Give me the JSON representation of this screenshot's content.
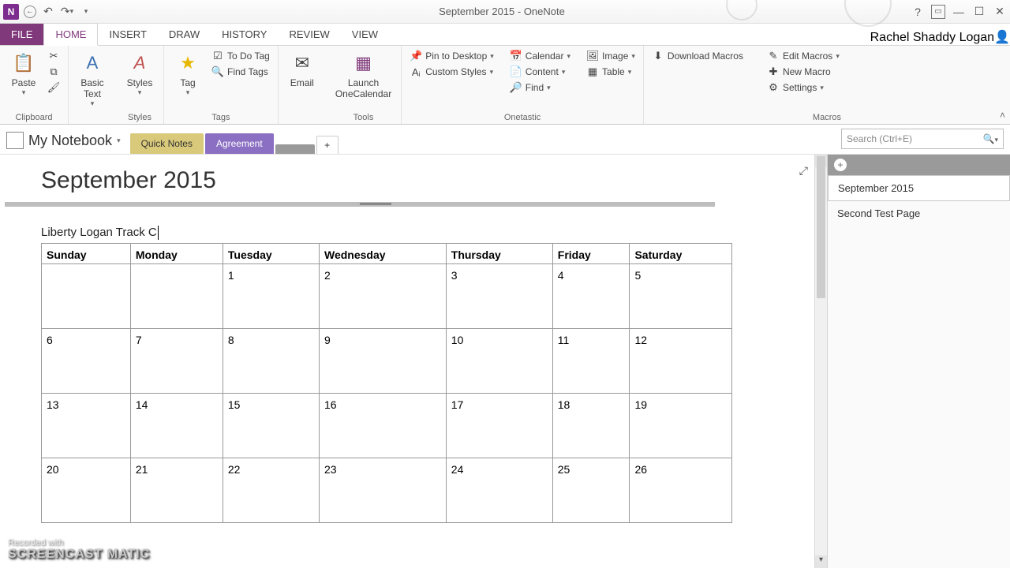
{
  "window": {
    "title": "September 2015 - OneNote"
  },
  "user": {
    "name": "Rachel Shaddy Logan"
  },
  "ribbon_tabs": [
    "FILE",
    "HOME",
    "INSERT",
    "DRAW",
    "HISTORY",
    "REVIEW",
    "VIEW"
  ],
  "active_tab": "HOME",
  "ribbon": {
    "clipboard": {
      "paste": "Paste",
      "title": "Clipboard"
    },
    "basictext": {
      "label1": "Basic",
      "label2": "Text",
      "title": ""
    },
    "styles": {
      "label": "Styles",
      "title": "Styles"
    },
    "tags": {
      "tag": "Tag",
      "todo": "To Do Tag",
      "find": "Find Tags",
      "title": "Tags"
    },
    "email": {
      "label": "Email"
    },
    "tools": {
      "launch1": "Launch",
      "launch2": "OneCalendar",
      "title": "Tools"
    },
    "onetastic": {
      "pin": "Pin to Desktop",
      "custom": "Custom Styles",
      "calendar": "Calendar",
      "content": "Content",
      "find": "Find",
      "image": "Image",
      "table": "Table",
      "title": "Onetastic"
    },
    "macros": {
      "download": "Download Macros",
      "edit": "Edit Macros",
      "new": "New Macro",
      "settings": "Settings",
      "title": "Macros"
    }
  },
  "notebook": {
    "name": "My Notebook"
  },
  "sections": [
    "Quick Notes",
    "Agreement",
    ""
  ],
  "search": {
    "placeholder": "Search (Ctrl+E)"
  },
  "page": {
    "title": "September 2015",
    "note_label": "Liberty Logan Track C"
  },
  "calendar": {
    "headers": [
      "Sunday",
      "Monday",
      "Tuesday",
      "Wednesday",
      "Thursday",
      "Friday",
      "Saturday"
    ],
    "rows": [
      [
        "",
        "",
        "1",
        "2",
        "3",
        "4",
        "5"
      ],
      [
        "6",
        "7",
        "8",
        "9",
        "10",
        "11",
        "12"
      ],
      [
        "13",
        "14",
        "15",
        "16",
        "17",
        "18",
        "19"
      ],
      [
        "20",
        "21",
        "22",
        "23",
        "24",
        "25",
        "26"
      ]
    ]
  },
  "pagelist": {
    "items": [
      "September 2015",
      "Second Test Page"
    ],
    "active_index": 0
  },
  "watermark": {
    "line1": "Recorded with",
    "line2": "SCREENCAST   MATIC"
  }
}
